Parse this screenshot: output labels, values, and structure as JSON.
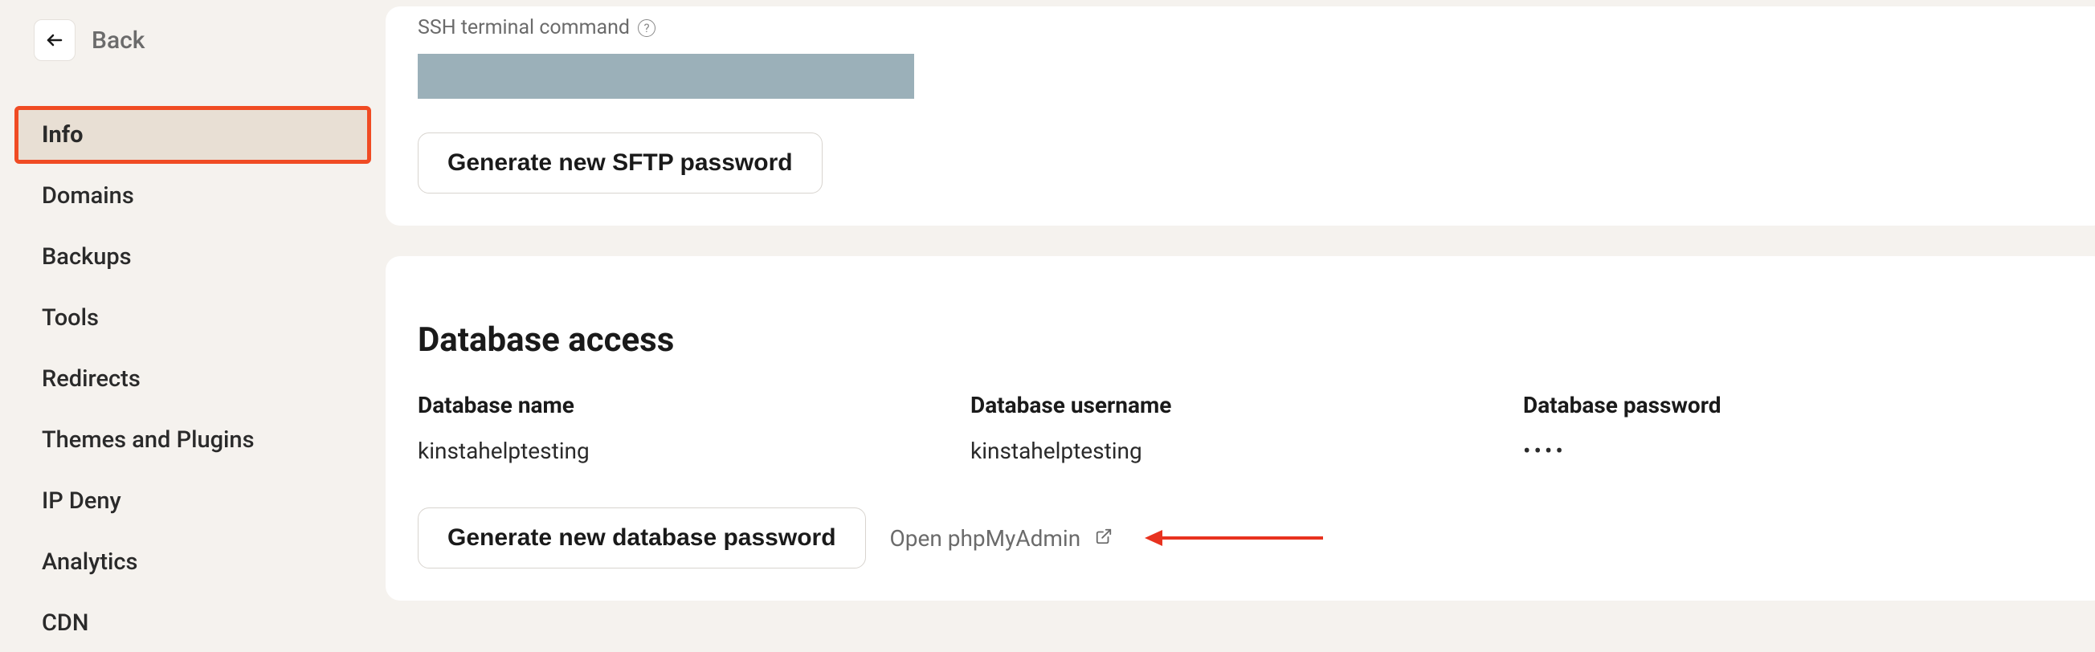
{
  "back": {
    "label": "Back"
  },
  "sidebar": {
    "items": [
      {
        "label": "Info",
        "active": true
      },
      {
        "label": "Domains",
        "active": false
      },
      {
        "label": "Backups",
        "active": false
      },
      {
        "label": "Tools",
        "active": false
      },
      {
        "label": "Redirects",
        "active": false
      },
      {
        "label": "Themes and Plugins",
        "active": false
      },
      {
        "label": "IP Deny",
        "active": false
      },
      {
        "label": "Analytics",
        "active": false
      },
      {
        "label": "CDN",
        "active": false
      }
    ]
  },
  "ssh": {
    "label": "SSH terminal command",
    "generate_button": "Generate new SFTP password"
  },
  "database": {
    "section_title": "Database access",
    "name_label": "Database name",
    "name_value": "kinstahelptesting",
    "username_label": "Database username",
    "username_value": "kinstahelptesting",
    "password_label": "Database password",
    "password_value": "••••",
    "generate_button": "Generate new database password",
    "open_link": "Open phpMyAdmin"
  }
}
